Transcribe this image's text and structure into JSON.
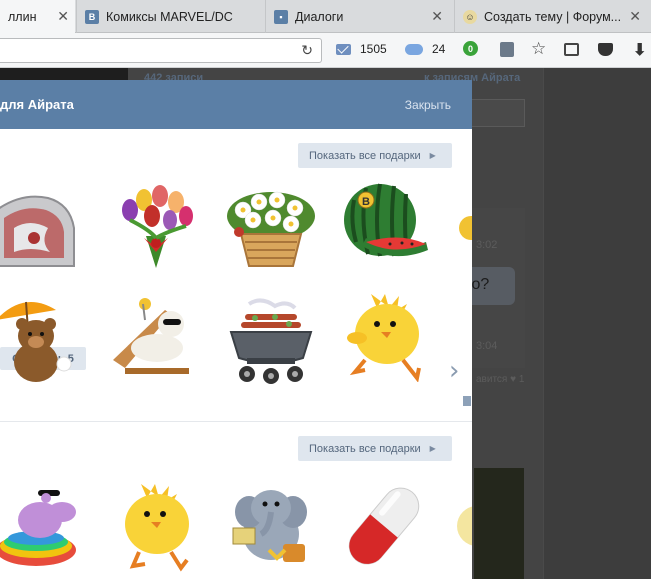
{
  "browser": {
    "tabs": [
      {
        "title": "ллин",
        "favicon": "none",
        "active": true
      },
      {
        "title": "Комиксы MARVEL/DC",
        "favicon": "vk-icon",
        "active": false
      },
      {
        "title": "Диалоги",
        "favicon": "vk-message-icon",
        "active": false
      },
      {
        "title": "Создать тему | Форум...",
        "favicon": "forum-icon",
        "active": false
      }
    ],
    "close_glyph": "✕",
    "reload_glyph": "↻",
    "mail_count": "1505",
    "cloud_count": "24",
    "badge_count": "0",
    "star_glyph": "☆",
    "download_glyph": "⬇"
  },
  "background": {
    "posts_count": "442 записи",
    "to_posts": "к записям Айрата",
    "time1": "3:02",
    "bubble_text": "го?",
    "time2": "3:04",
    "likes": "авится ♥ 1"
  },
  "modal": {
    "title": "для Айрата",
    "close_label": "Закрыть",
    "show_all_label": "Показать все подарки",
    "show_all_arrow": "▶",
    "remaining_label": "Осталось 5",
    "next_glyph": "›",
    "gifts": [
      {
        "name": "dota-shield-gift"
      },
      {
        "name": "tulip-bouquet-gift"
      },
      {
        "name": "flower-basket-gift"
      },
      {
        "name": "watermelon-gift"
      },
      {
        "name": "umbrella-bear-gift"
      },
      {
        "name": "sunbathing-bear-gift"
      },
      {
        "name": "barbecue-grill-gift"
      },
      {
        "name": "yellow-chick-gift"
      },
      {
        "name": "hippo-pool-gift"
      },
      {
        "name": "dancing-chick-gift"
      },
      {
        "name": "elephant-gift"
      },
      {
        "name": "pill-capsule-gift"
      }
    ]
  },
  "colors": {
    "vk_blue": "#5b7fa6",
    "button_bg": "#dfe6ee",
    "button_text": "#55677d"
  }
}
